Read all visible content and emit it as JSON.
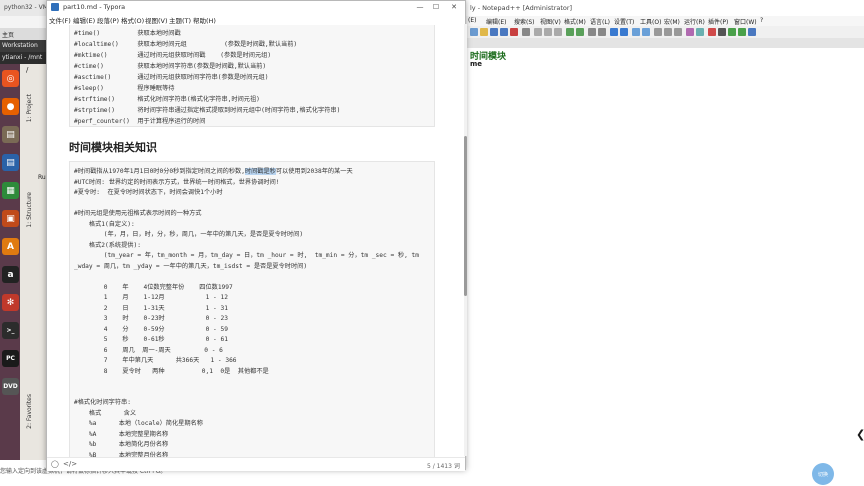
{
  "vm": {
    "title": "python32 - VM",
    "menu_home": "主页",
    "tab_workstation": "Workstation",
    "tab_path": "ytianxi - /mnt",
    "tab_slash": "/",
    "favorites_tab": "2: Favorites",
    "structure_tab": "1: Structure",
    "project_tab": "1: Project",
    "run_label": "Ru",
    "status_bar": "您输入定向到该虚拟机，请将鼠标指针移入其中或按 Ctrl+G。"
  },
  "launcher": {
    "icons": [
      {
        "name": "ubuntu-icon",
        "glyph": "◎",
        "color": "#e95420"
      },
      {
        "name": "firefox-icon",
        "glyph": "●",
        "color": "#e66000"
      },
      {
        "name": "files-icon",
        "glyph": "▤",
        "color": "#7a6a55"
      },
      {
        "name": "writer-icon",
        "glyph": "▤",
        "color": "#2a62a8"
      },
      {
        "name": "calc-icon",
        "glyph": "▦",
        "color": "#2e8b3a"
      },
      {
        "name": "impress-icon",
        "glyph": "▣",
        "color": "#c04a1a"
      },
      {
        "name": "software-icon",
        "glyph": "A",
        "color": "#e07a10"
      },
      {
        "name": "amazon-icon",
        "glyph": "a",
        "color": "#222222"
      },
      {
        "name": "settings-icon",
        "glyph": "✻",
        "color": "#c0392b"
      },
      {
        "name": "terminal-icon",
        "glyph": ">_",
        "color": "#2c2c2c"
      },
      {
        "name": "pycharm-icon",
        "glyph": "PC",
        "color": "#1a1a1a"
      },
      {
        "name": "dvd-icon",
        "glyph": "DVD",
        "color": "#555555"
      }
    ]
  },
  "notepadpp": {
    "title": "ly - Notepad++ [Administrator]",
    "menus": [
      "(E)",
      "编辑(E)",
      "搜索(S)",
      "视图(V)",
      "格式(M)",
      "语言(L)",
      "设置(T)",
      "工具(O)",
      "宏(M)",
      "运行(R)",
      "插件(P)",
      "窗口(W)",
      "?"
    ],
    "heading": "时间模块",
    "line2": "me",
    "float_button": "切换"
  },
  "typora": {
    "title": "part10.md - Typora",
    "controls": {
      "minimize": "—",
      "maximize": "☐",
      "close": "✕"
    },
    "menus": [
      "文件(F)",
      "编辑(E)",
      "段落(P)",
      "格式(O)",
      "视图(V)",
      "主题(T)",
      "帮助(H)"
    ],
    "top_code": [
      "#time()          获取本地时间戳",
      "#localtime()     获取本地时间元组          (参数是时间戳,默认当前)",
      "#mktime()        通过时间元组获取时间戳    (参数是时间元组)",
      "#ctime()         获取本地时间字符串(参数是时间戳,默认当前)",
      "#asctime()       通过时间元组获取时间字符串(参数是时间元组)",
      "#sleep()         程序睡眠等待",
      "#strftime()      格式化时间字符串(格式化字符串,时间元祖)",
      "#strptime()      将时间字符串通过指定格式提取到时间元组中(时间字符串,格式化字符串)",
      "#perf_counter()  用于计算程序运行的时间"
    ],
    "section_heading": "时间模块相关知识",
    "main_code": [
      "#时间戳指从1970年1月1日0时0分0秒到指定时间之间的秒数,",
      "#UTC时间: 世界约定的时间表示方式，世界统一时间格式，世界协调时间!",
      "#夏令时:  在夏令时时间状态下，时间会调快1个小时",
      "",
      "#时间元组是使用元祖格式表示时间的一种方式",
      "    格式1(自定义):",
      "        (年，月，日，时，分，秒，周几，一年中的第几天，是否是夏令时时间)",
      "    格式2(系统提供):",
      "        (tm_year = 年，tm_month = 月，tm_day = 日，tm _hour = 时,  tm_min = 分，tm _sec = 秒, tm",
      "_wday = 周几，tm _yday = 一年中的第几天，tm_isdst = 是否是夏令时时间)",
      "",
      "        0    年    4位数完整年份    四位数1997",
      "        1    月    1-12月           1 - 12",
      "        2    日    1-31天           1 - 31",
      "        3    时    0-23时           0 - 23",
      "        4    分    0-59分           0 - 59",
      "        5    秒    0-61秒           0 - 61",
      "        6    周几  周一-周天         0 - 6",
      "        7    年中第几天      共366天   1 - 366",
      "        8    夏令时   两种          0,1  0是  其他都不是",
      "",
      "",
      "#格式化时间字符串:",
      "    格式      含义",
      "    %a      本地（locale）简化星期名称",
      "    %A      本地完整星期名称",
      "    %b      本地简化月份名称",
      "    %B      本地完整月份名称"
    ],
    "selected_text": "时间戳是秒",
    "line1_suffix": "可以使用到2038年的某一天",
    "footer": {
      "left": "◯",
      "code": "</>",
      "wordcount": "5 / 1413 词"
    }
  }
}
